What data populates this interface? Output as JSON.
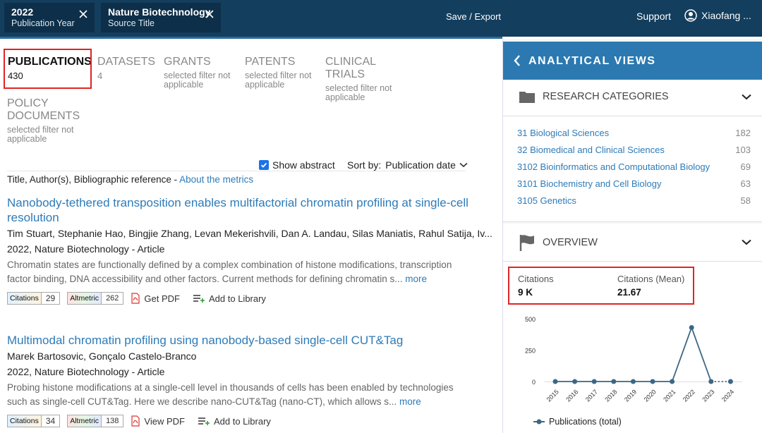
{
  "topbar": {
    "filters": [
      {
        "value": "2022",
        "label": "Publication Year"
      },
      {
        "value": "Nature Biotechnology",
        "label": "Source Title"
      }
    ],
    "save_export": "Save / Export",
    "support": "Support",
    "user": "Xiaofang ..."
  },
  "tabs": [
    {
      "title": "PUBLICATIONS",
      "count": "430"
    },
    {
      "title": "DATASETS",
      "count": "4"
    },
    {
      "title": "GRANTS",
      "count": "selected filter not applicable"
    },
    {
      "title": "PATENTS",
      "count": "selected filter not applicable"
    },
    {
      "title": "CLINICAL TRIALS",
      "count": "selected filter not applicable"
    },
    {
      "title": "POLICY DOCUMENTS",
      "count": "selected filter not applicable"
    }
  ],
  "controls": {
    "show_abstract": "Show abstract",
    "sort_label": "Sort by:",
    "sort_value": "Publication date"
  },
  "metrics_line": {
    "text": "Title, Author(s), Bibliographic reference - ",
    "link": "About the metrics"
  },
  "publications": [
    {
      "title": "Nanobody-tethered transposition enables multifactorial chromatin profiling at single-cell resolution",
      "authors": "Tim Stuart, Stephanie Hao, Bingjie Zhang, Levan Mekerishvili, Dan A. Landau, Silas Maniatis, Rahul Satija, Iv...",
      "source": "2022, Nature Biotechnology - Article",
      "abstract": "Chromatin states are functionally defined by a complex combination of histone modifications, transcription factor binding, DNA accessibility and other factors. Current methods for defining chromatin s...",
      "more": "more",
      "citations_label": "Citations",
      "citations": "29",
      "altmetric_label": "Altmetric",
      "altmetric": "262",
      "pdf_action": "Get PDF",
      "library_action": "Add to Library"
    },
    {
      "title": "Multimodal chromatin profiling using nanobody-based single-cell CUT&Tag",
      "authors": "Marek Bartosovic, Gonçalo Castelo-Branco",
      "source": "2022, Nature Biotechnology - Article",
      "abstract": "Probing histone modifications at a single-cell level in thousands of cells has been enabled by technologies such as single-cell CUT&Tag. Here we describe nano-CUT&Tag (nano-CT), which allows s...",
      "more": "more",
      "citations_label": "Citations",
      "citations": "34",
      "altmetric_label": "Altmetric",
      "altmetric": "138",
      "pdf_action": "View PDF",
      "library_action": "Add to Library"
    }
  ],
  "panel": {
    "title": "ANALYTICAL VIEWS",
    "research_categories": {
      "title": "RESEARCH CATEGORIES",
      "items": [
        {
          "name": "31 Biological Sciences",
          "count": "182"
        },
        {
          "name": "32 Biomedical and Clinical Sciences",
          "count": "103"
        },
        {
          "name": "3102 Bioinformatics and Computational Biology",
          "count": "69"
        },
        {
          "name": "3101 Biochemistry and Cell Biology",
          "count": "63"
        },
        {
          "name": "3105 Genetics",
          "count": "58"
        }
      ]
    },
    "overview": {
      "title": "OVERVIEW",
      "citations_label": "Citations",
      "citations_value": "9 K",
      "mean_label": "Citations (Mean)",
      "mean_value": "21.67"
    }
  },
  "colors": {
    "topbar": "#143e5d",
    "panel_header": "#2b79b0",
    "link": "#2e7bb8",
    "highlight": "#e12424",
    "series": "#3d6784"
  },
  "chart_data": {
    "type": "line",
    "x": [
      "2015",
      "2016",
      "2017",
      "2018",
      "2019",
      "2020",
      "2021",
      "2022",
      "2023",
      "2024"
    ],
    "yticks": [
      "0",
      "250",
      "500"
    ],
    "ylim": [
      0,
      500
    ],
    "series": [
      {
        "name": "Publications (total)",
        "values": [
          0,
          0,
          0,
          0,
          0,
          0,
          0,
          430,
          0,
          0
        ],
        "dashed_last": true
      }
    ],
    "legend": "bottom-left"
  }
}
